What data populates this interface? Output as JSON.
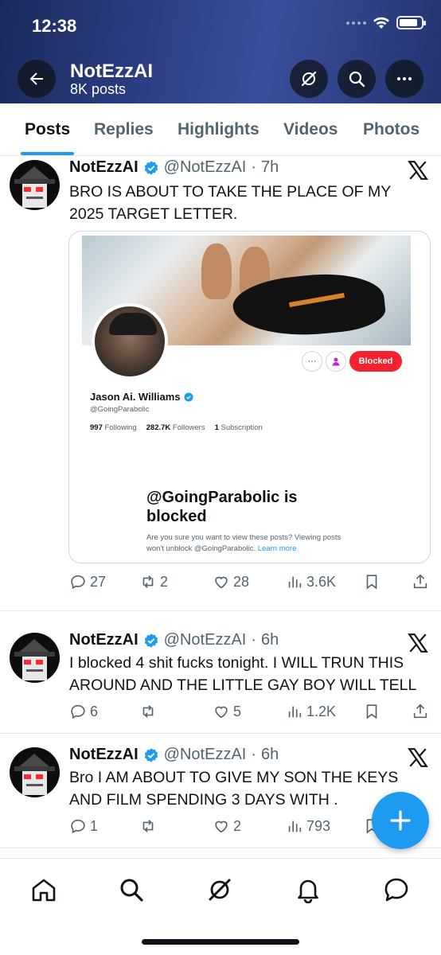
{
  "status_bar": {
    "time": "12:38"
  },
  "header": {
    "account_name": "NotEzzAI",
    "posts_count": "8K posts"
  },
  "tabs": [
    {
      "label": "Posts",
      "active": true
    },
    {
      "label": "Replies",
      "active": false
    },
    {
      "label": "Highlights",
      "active": false
    },
    {
      "label": "Videos",
      "active": false
    },
    {
      "label": "Photos",
      "active": false
    }
  ],
  "posts": [
    {
      "name": "NotEzzAI",
      "handle": "@NotEzzAI",
      "time": "7h",
      "lines": [
        "BRO IS ABOUT TO TAKE THE PLACE OF MY",
        "2025 TARGET LETTER."
      ],
      "replies": "27",
      "reposts": "2",
      "likes": "28",
      "views": "3.6K",
      "embed": {
        "profile_name": "Jason Ai. Williams",
        "profile_handle": "@GoingParabolic",
        "following_count": "997",
        "following_label": "Following",
        "followers_count": "282.7K",
        "followers_label": "Followers",
        "subscription_count": "1",
        "subscription_label": "Subscription",
        "blocked_button": "Blocked",
        "more_glyph": "···",
        "blocked_title": "@GoingParabolic is blocked",
        "blocked_desc": "Are you sure you want to view these posts? Viewing posts won't unblock @GoingParabolic.",
        "learn_more": "Learn more"
      }
    },
    {
      "name": "NotEzzAI",
      "handle": "@NotEzzAI",
      "time": "6h",
      "lines": [
        "I blocked 4 shit fucks tonight. I WILL TRUN THIS",
        "AROUND AND THE LITTLE GAY BOY WILL TELL"
      ],
      "replies": "6",
      "reposts": "",
      "likes": "5",
      "views": "1.2K"
    },
    {
      "name": "NotEzzAI",
      "handle": "@NotEzzAI",
      "time": "6h",
      "lines": [
        "Bro I AM ABOUT TO GIVE MY SON THE KEYS",
        "AND FILM SPENDING 3 DAYS WITH ."
      ],
      "replies": "1",
      "reposts": "",
      "likes": "2",
      "views": "793"
    }
  ],
  "separator": "·",
  "icons": {
    "header": [
      "back-arrow-icon",
      "grok-icon",
      "search-icon",
      "more-icon"
    ],
    "nav": [
      "home-icon",
      "search-icon",
      "grok-icon",
      "notifications-icon",
      "messages-icon"
    ],
    "post_actions": [
      "reply-icon",
      "repost-icon",
      "like-icon",
      "views-icon",
      "bookmark-icon",
      "share-icon"
    ],
    "fab": "compose-plus-icon"
  },
  "colors": {
    "accent": "#1d9bf0",
    "blocked": "#f4212e",
    "text": "#0f1419",
    "muted": "#536471"
  }
}
